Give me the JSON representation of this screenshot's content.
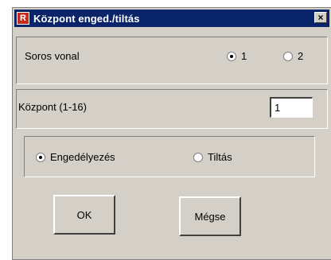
{
  "window": {
    "title": "Központ enged./tiltás",
    "close_glyph": "×"
  },
  "line_group": {
    "label": "Soros vonal",
    "options": [
      {
        "label": "1",
        "selected": true
      },
      {
        "label": "2",
        "selected": false
      }
    ]
  },
  "center_group": {
    "label": "Központ (1-16)",
    "value": "1"
  },
  "mode_group": {
    "options": [
      {
        "label": "Engedélyezés",
        "selected": true
      },
      {
        "label": "Tiltás",
        "selected": false
      }
    ]
  },
  "buttons": {
    "ok": "OK",
    "cancel": "Mégse"
  }
}
